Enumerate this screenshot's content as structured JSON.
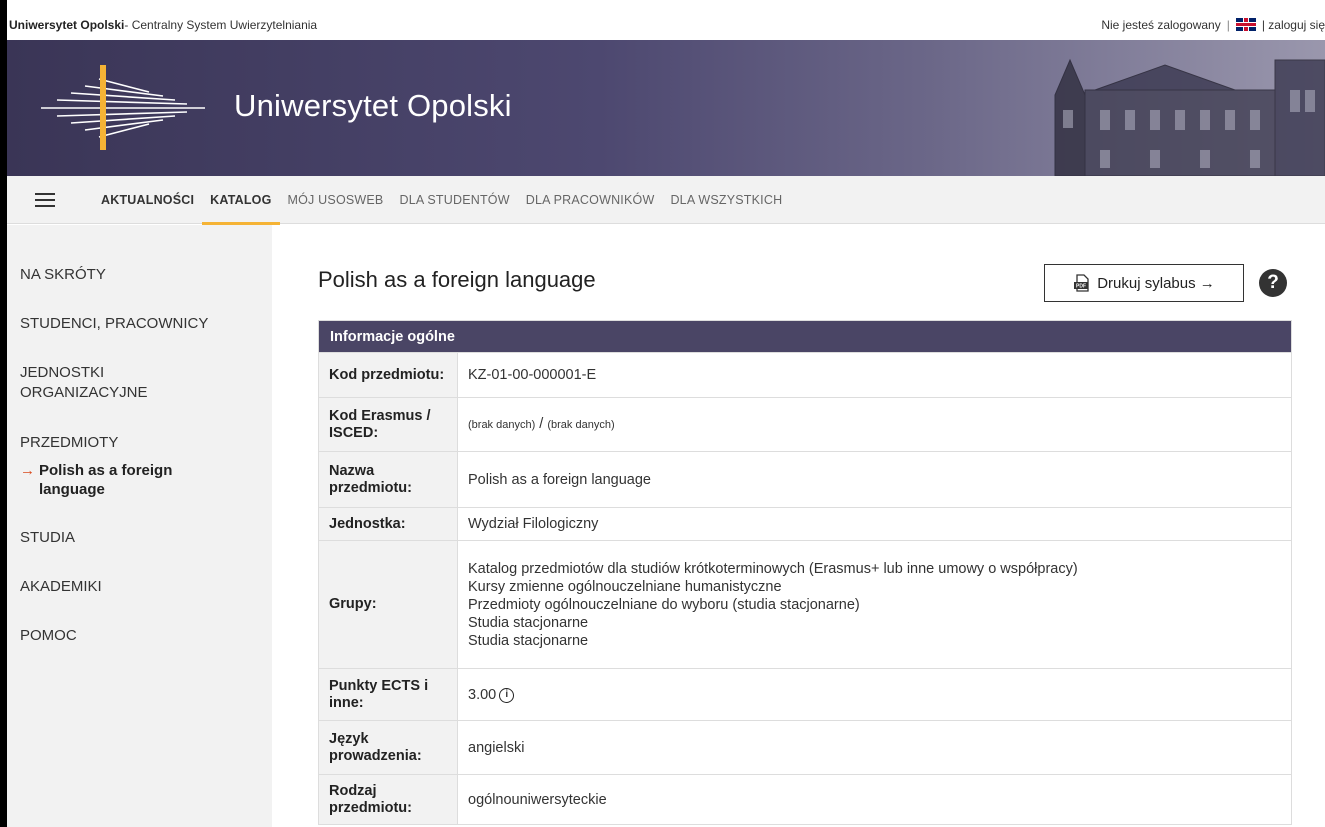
{
  "topbar": {
    "university": "Uniwersytet Opolski",
    "system": " - Centralny System Uwierzytelniania",
    "status": "Nie jesteś zalogowany",
    "separator": "|",
    "login": "| zaloguj się"
  },
  "banner": {
    "title": "Uniwersytet Opolski"
  },
  "nav": {
    "items": [
      {
        "label": "AKTUALNOŚCI"
      },
      {
        "label": "KATALOG"
      },
      {
        "label": "MÓJ USOSWEB"
      },
      {
        "label": "DLA STUDENTÓW"
      },
      {
        "label": "DLA PRACOWNIKÓW"
      },
      {
        "label": "DLA WSZYSTKICH"
      }
    ]
  },
  "sidebar": {
    "items": [
      {
        "label": "NA SKRÓTY"
      },
      {
        "label": "STUDENCI, PRACOWNICY"
      },
      {
        "label": "JEDNOSTKI ORGANIZACYJNE"
      },
      {
        "label": "PRZEDMIOTY"
      },
      {
        "label": "STUDIA"
      },
      {
        "label": "AKADEMIKI"
      },
      {
        "label": "POMOC"
      }
    ],
    "sub": {
      "arrow": "→",
      "label": "Polish as a foreign language"
    }
  },
  "content": {
    "title": "Polish as a foreign language",
    "print_label": "Drukuj sylabus →",
    "help": "?",
    "table_header": "Informacje ogólne",
    "rows": [
      {
        "label": "Kod przedmiotu:",
        "value": "KZ-01-00-000001-E"
      },
      {
        "label": "Kod Erasmus / ISCED:",
        "value_a": "(brak danych)",
        "value_sep": " / ",
        "value_b": "(brak danych)"
      },
      {
        "label": "Nazwa przedmiotu:",
        "value": "Polish as a foreign language"
      },
      {
        "label": "Jednostka:",
        "value": "Wydział Filologiczny"
      },
      {
        "label": "Grupy:",
        "values": [
          "Katalog przedmiotów dla studiów krótkoterminowych (Erasmus+ lub inne umowy o współpracy)",
          "Kursy zmienne ogólnouczelniane humanistyczne",
          "Przedmioty ogólnouczelniane do wyboru (studia stacjonarne)",
          "Studia stacjonarne",
          "Studia stacjonarne"
        ]
      },
      {
        "label": "Punkty ECTS i inne:",
        "value": "3.00",
        "info": "i"
      },
      {
        "label": "Język prowadzenia:",
        "value": "angielski"
      },
      {
        "label": "Rodzaj przedmiotu:",
        "value": "ogólnouniwersyteckie"
      }
    ]
  },
  "colors": {
    "banner": "#4a4565",
    "accent": "#f5b335",
    "arrow": "#d94a1e"
  }
}
